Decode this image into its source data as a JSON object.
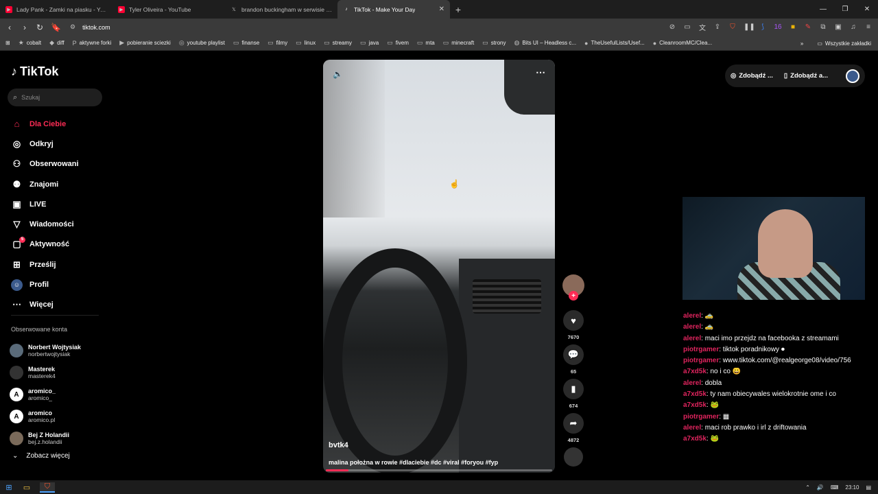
{
  "browser": {
    "tabs": [
      {
        "title": "Lady Pank - Zamki na piasku - YouTube",
        "icon": "youtube-icon",
        "color": "#ff0033"
      },
      {
        "title": "Tyler Oliveira - YouTube",
        "icon": "youtube-icon",
        "color": "#ff0033"
      },
      {
        "title": "brandon buckingham w serwisie X: ,",
        "icon": "x-icon",
        "color": "#ffffff"
      },
      {
        "title": "TikTok - Make Your Day",
        "icon": "tiktok-icon",
        "color": "#ffffff"
      }
    ],
    "url": "tiktok.com",
    "bookmarks": [
      "cobalt",
      "diff",
      "aktywne forki",
      "pobieranie sciezki",
      "youtube playlist",
      "finanse",
      "filmy",
      "linux",
      "streamy",
      "java",
      "fivem",
      "mta",
      "minecraft",
      "strony",
      "Bits UI – Headless c...",
      "TheUsefulLists/Usef...",
      "CleanroomMC/Clea..."
    ],
    "all_bookmarks": "Wszystkie zakładki",
    "ext_badge": "16"
  },
  "tiktok": {
    "logo": "TikTok",
    "search_placeholder": "Szukaj",
    "nav": [
      {
        "label": "Dla Ciebie",
        "icon": "home-icon"
      },
      {
        "label": "Odkryj",
        "icon": "compass-icon"
      },
      {
        "label": "Obserwowani",
        "icon": "following-icon"
      },
      {
        "label": "Znajomi",
        "icon": "friends-icon"
      },
      {
        "label": "LIVE",
        "icon": "live-icon"
      },
      {
        "label": "Wiadomości",
        "icon": "messages-icon"
      },
      {
        "label": "Aktywność",
        "icon": "activity-icon"
      },
      {
        "label": "Prześlij",
        "icon": "upload-icon"
      },
      {
        "label": "Profil",
        "icon": "profile-icon"
      },
      {
        "label": "Więcej",
        "icon": "more-icon"
      }
    ],
    "activity_badge": "5",
    "followed_title": "Obserwowane konta",
    "followed": [
      {
        "name": "Norbert Wojtysiak",
        "handle": "norbertwojtysiak"
      },
      {
        "name": "Masterek",
        "handle": "masterek4"
      },
      {
        "name": "aromico_",
        "handle": "aromico_"
      },
      {
        "name": "aromico",
        "handle": "aromico.pl"
      },
      {
        "name": "Bej Z Holandii",
        "handle": "bej.z.holandii"
      }
    ],
    "see_more": "Zobacz więcej",
    "video": {
      "author": "bvtk4",
      "caption": "malina położna w rowie #dlaciebie #dc #viral #foryou #fyp",
      "likes": "7670",
      "comments": "65",
      "saves": "674",
      "shares": "4872",
      "progress": 0.1
    },
    "top_buttons": [
      "Zdobądź ...",
      "Zdobądź a..."
    ]
  },
  "chat": [
    {
      "user": "alerel",
      "msg": ": 🚕"
    },
    {
      "user": "alerel",
      "msg": ": 🚕"
    },
    {
      "user": "alerel",
      "msg": ": maci imo przejdz na facebooka z streamami"
    },
    {
      "user": "piotrgamer",
      "msg": ": tiktok poradnikowy ⏺"
    },
    {
      "user": "piotrgamer",
      "msg": ": www.tiktok.com/@realgeorge08/video/756"
    },
    {
      "user": "a7xd5k",
      "msg": ": no i co 😀"
    },
    {
      "user": "alerel",
      "msg": ": dobla"
    },
    {
      "user": "a7xd5k",
      "msg": ": ty nam obiecywales wielokrotnie ome i co"
    },
    {
      "user": "a7xd5k",
      "msg": ": 🐸"
    },
    {
      "user": "piotrgamer",
      "msg": ": ▦"
    },
    {
      "user": "alerel",
      "msg": ": maci rob prawko i irl z driftowania"
    },
    {
      "user": "a7xd5k",
      "msg": ": 🐸"
    }
  ],
  "taskbar": {
    "time": "23:10"
  }
}
